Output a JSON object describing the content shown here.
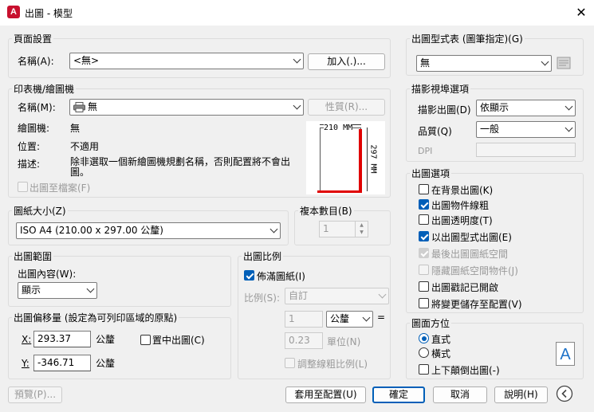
{
  "window": {
    "title": "出圖 - 模型",
    "app_icon": "A"
  },
  "page_setup": {
    "title": "頁面設置",
    "name_label": "名稱(A):",
    "name_value": "<無>",
    "add_button": "加入(.)..."
  },
  "printer": {
    "title": "印表機/繪圖機",
    "name_label": "名稱(M):",
    "name_value": "無",
    "properties_button": "性質(R)...",
    "plotter_label": "繪圖機:",
    "plotter_value": "無",
    "where_label": "位置:",
    "where_value": "不適用",
    "desc_label": "描述:",
    "desc_value": "除非選取一個新繪圖機規劃名稱，否則配置將不會出圖。",
    "plot_to_file": "出圖至檔案(F)",
    "preview_width": "210 MM",
    "preview_height": "297 MM"
  },
  "paper_size": {
    "title": "圖紙大小(Z)",
    "value": "ISO A4 (210.00 x 297.00 公釐)"
  },
  "copies": {
    "title": "複本數目(B)",
    "value": "1"
  },
  "plot_area": {
    "title": "出圖範圍",
    "what_label": "出圖內容(W):",
    "what_value": "顯示"
  },
  "plot_offset": {
    "title": "出圖偏移量 (設定為可列印區域的原點)",
    "x_label": "X:",
    "x_value": "293.37",
    "x_unit": "公釐",
    "y_label": "Y:",
    "y_value": "-346.71",
    "y_unit": "公釐",
    "center": "置中出圖(C)"
  },
  "plot_scale": {
    "title": "出圖比例",
    "fit": "佈滿圖紙(I)",
    "scale_label": "比例(S):",
    "scale_value": "自訂",
    "num_value": "1",
    "unit_value": "公釐",
    "equals": "=",
    "units_value": "0.23",
    "units_label": "單位(N)",
    "lineweights": "調整線粗比例(L)"
  },
  "plot_style": {
    "title": "出圖型式表 (圖筆指定)(G)",
    "value": "無"
  },
  "shaded": {
    "title": "描影視埠選項",
    "shade_label": "描影出圖(D)",
    "shade_value": "依顯示",
    "quality_label": "品質(Q)",
    "quality_value": "一般",
    "dpi_label": "DPI"
  },
  "plot_options": {
    "title": "出圖選項",
    "items": [
      {
        "label": "在背景出圖(K)",
        "state": "off"
      },
      {
        "label": "出圖物件線粗",
        "state": "on"
      },
      {
        "label": "出圖透明度(T)",
        "state": "off"
      },
      {
        "label": "以出圖型式出圖(E)",
        "state": "on"
      },
      {
        "label": "最後出圖圖紙空間",
        "state": "disabled-on"
      },
      {
        "label": "隱藏圖紙空間物件(J)",
        "state": "disabled-off"
      },
      {
        "label": "出圖戳記已開啟",
        "state": "off"
      },
      {
        "label": "將變更儲存至配置(V)",
        "state": "off"
      }
    ]
  },
  "orientation": {
    "title": "圖面方位",
    "portrait": "直式",
    "landscape": "橫式",
    "upside_down": "上下顛倒出圖(-)",
    "icon_letter": "A"
  },
  "footer": {
    "preview": "預覽(P)...",
    "apply": "套用至配置(U)",
    "ok": "確定",
    "cancel": "取消",
    "help": "說明(H)"
  },
  "colors": {
    "accent": "#005fb8",
    "preview_red": "#e00000"
  }
}
